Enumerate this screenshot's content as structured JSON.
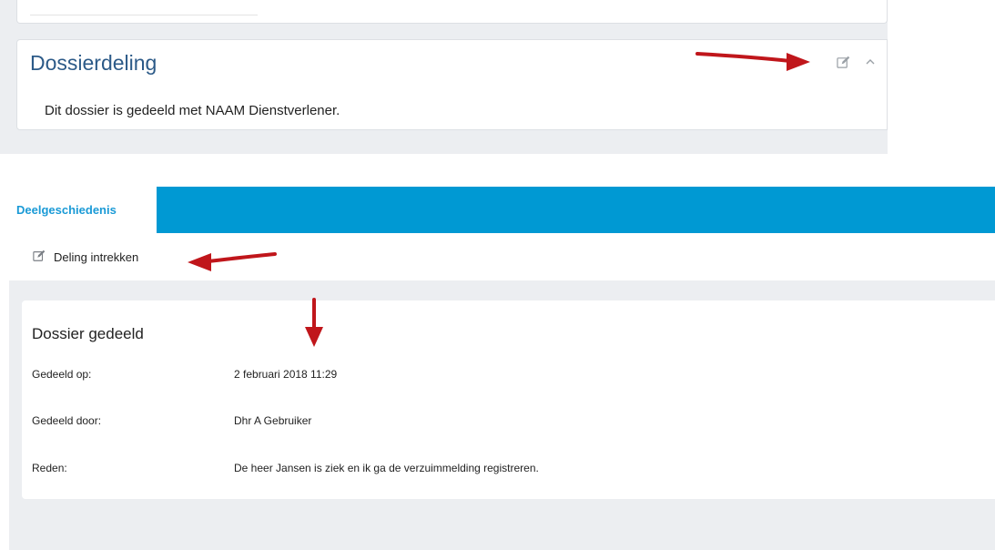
{
  "dossier_panel": {
    "title": "Dossierdeling",
    "message": "Dit dossier is gedeeld met NAAM Dienstverlener.",
    "edit_icon": "edit-icon",
    "collapse_icon": "chevron-up-icon"
  },
  "tabs": [
    {
      "label": "Deelgeschiedenis",
      "active": true
    }
  ],
  "toolbar": {
    "withdraw_label": "Deling intrekken",
    "withdraw_icon": "edit-icon"
  },
  "history": {
    "title": "Dossier gedeeld",
    "rows": [
      {
        "label": "Gedeeld op:",
        "value": "2 februari 2018 11:29"
      },
      {
        "label": "Gedeeld door:",
        "value": "Dhr A Gebruiker"
      },
      {
        "label": "Reden:",
        "value": "De heer Jansen is ziek en ik ga de verzuimmelding registreren."
      }
    ]
  },
  "colors": {
    "tab_bar": "#0099d3",
    "title_blue": "#2c5a88",
    "tab_label": "#1a9ad6",
    "panel_bg": "#eceef1",
    "annotation_arrow": "#c0161b"
  }
}
